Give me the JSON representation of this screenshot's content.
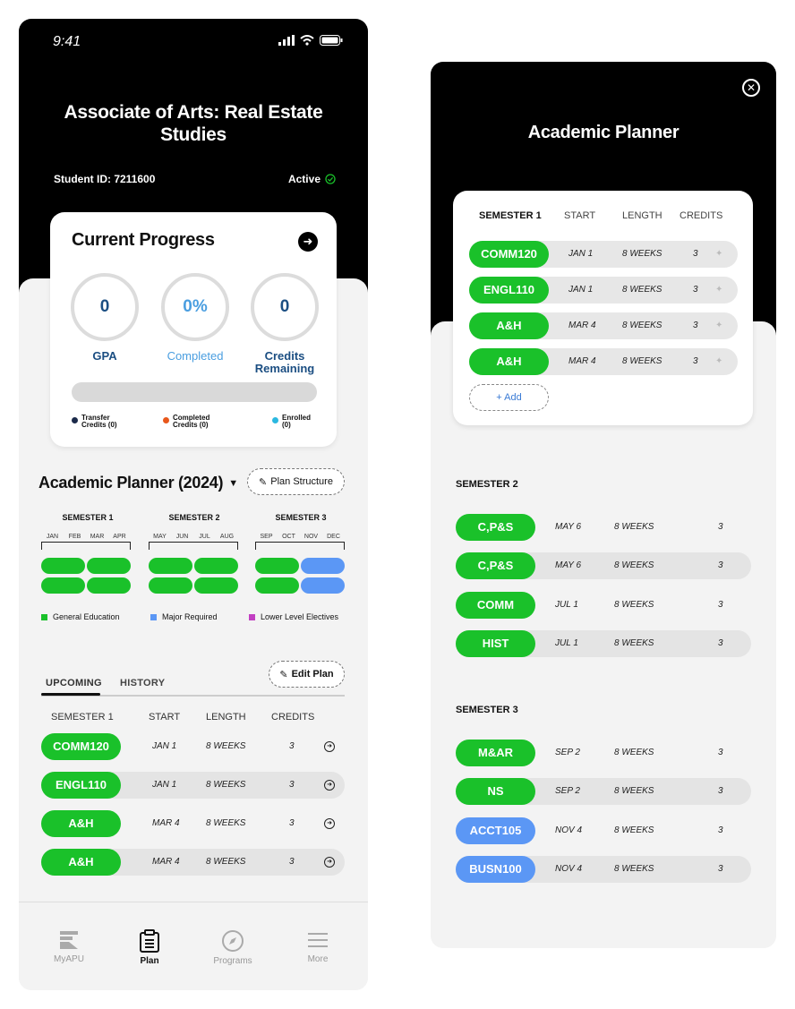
{
  "status": {
    "time": "9:41"
  },
  "program": {
    "title": "Associate of Arts: Real Estate Studies",
    "student_id": "Student ID: 7211600",
    "status": "Active"
  },
  "progress": {
    "title": "Current Progress",
    "gpa": "0",
    "gpa_label": "GPA",
    "completed": "0%",
    "completed_label": "Completed",
    "credits_remaining": "0",
    "credits_remaining_label_1": "Credits",
    "credits_remaining_label_2": "Remaining",
    "progress_fraction": 0,
    "legend": [
      {
        "l1": "Transfer",
        "l2": "Credits (0)",
        "color": "#1b2a4a"
      },
      {
        "l1": "Completed",
        "l2": "Credits (0)",
        "color": "#e8571b"
      },
      {
        "l1": "Enrolled",
        "l2": "(0)",
        "color": "#2bb8e0"
      }
    ],
    "colors": {
      "dark": "#1b4e82",
      "light": "#4a9ee0"
    }
  },
  "planner": {
    "title": "Academic Planner (2024)",
    "plan_structure_label": "Plan Structure",
    "semesters": [
      {
        "name": "SEMESTER 1",
        "months": [
          "JAN",
          "FEB",
          "MAR",
          "APR"
        ],
        "blocks": [
          "green",
          "green",
          "green",
          "green"
        ]
      },
      {
        "name": "SEMESTER 2",
        "months": [
          "MAY",
          "JUN",
          "JUL",
          "AUG"
        ],
        "blocks": [
          "green",
          "green",
          "green",
          "green"
        ]
      },
      {
        "name": "SEMESTER 3",
        "months": [
          "SEP",
          "OCT",
          "NOV",
          "DEC"
        ],
        "blocks": [
          "green",
          "blue",
          "green",
          "blue"
        ]
      }
    ],
    "legend": [
      {
        "label": "General Education",
        "color": "#1ac12a"
      },
      {
        "label": "Major Required",
        "color": "#5b97f5"
      },
      {
        "label": "Lower Level Electives",
        "color": "#c23fc2"
      }
    ],
    "edit_plan_label": "Edit Plan",
    "tabs": [
      "UPCOMING",
      "HISTORY"
    ],
    "columns": [
      "SEMESTER 1",
      "START",
      "LENGTH",
      "CREDITS"
    ],
    "courses": [
      {
        "code": "COMM120",
        "start": "JAN 1",
        "length": "8 WEEKS",
        "credits": "3"
      },
      {
        "code": "ENGL110",
        "start": "JAN 1",
        "length": "8 WEEKS",
        "credits": "3"
      },
      {
        "code": "A&H",
        "start": "MAR 4",
        "length": "8 WEEKS",
        "credits": "3"
      },
      {
        "code": "A&H",
        "start": "MAR 4",
        "length": "8 WEEKS",
        "credits": "3"
      }
    ]
  },
  "nav": [
    "MyAPU",
    "Plan",
    "Programs",
    "More"
  ],
  "panel": {
    "title": "Academic Planner",
    "columns": [
      "SEMESTER 1",
      "START",
      "LENGTH",
      "CREDITS"
    ],
    "sem1": [
      {
        "code": "COMM120",
        "start": "JAN 1",
        "length": "8 WEEKS",
        "credits": "3"
      },
      {
        "code": "ENGL110",
        "start": "JAN 1",
        "length": "8 WEEKS",
        "credits": "3"
      },
      {
        "code": "A&H",
        "start": "MAR 4",
        "length": "8 WEEKS",
        "credits": "3"
      },
      {
        "code": "A&H",
        "start": "MAR 4",
        "length": "8 WEEKS",
        "credits": "3"
      }
    ],
    "add_label": "+ Add",
    "sem2_title": "SEMESTER 2",
    "sem2": [
      {
        "code": "C,P&S",
        "start": "MAY 6",
        "length": "8 WEEKS",
        "credits": "3",
        "color": "green"
      },
      {
        "code": "C,P&S",
        "start": "MAY 6",
        "length": "8 WEEKS",
        "credits": "3",
        "color": "green"
      },
      {
        "code": "COMM",
        "start": "JUL 1",
        "length": "8 WEEKS",
        "credits": "3",
        "color": "green"
      },
      {
        "code": "HIST",
        "start": "JUL 1",
        "length": "8 WEEKS",
        "credits": "3",
        "color": "green"
      }
    ],
    "sem3_title": "SEMESTER 3",
    "sem3": [
      {
        "code": "M&AR",
        "start": "SEP 2",
        "length": "8 WEEKS",
        "credits": "3",
        "color": "green"
      },
      {
        "code": "NS",
        "start": "SEP 2",
        "length": "8 WEEKS",
        "credits": "3",
        "color": "green"
      },
      {
        "code": "ACCT105",
        "start": "NOV 4",
        "length": "8 WEEKS",
        "credits": "3",
        "color": "blue"
      },
      {
        "code": "BUSN100",
        "start": "NOV 4",
        "length": "8 WEEKS",
        "credits": "3",
        "color": "blue"
      }
    ]
  }
}
